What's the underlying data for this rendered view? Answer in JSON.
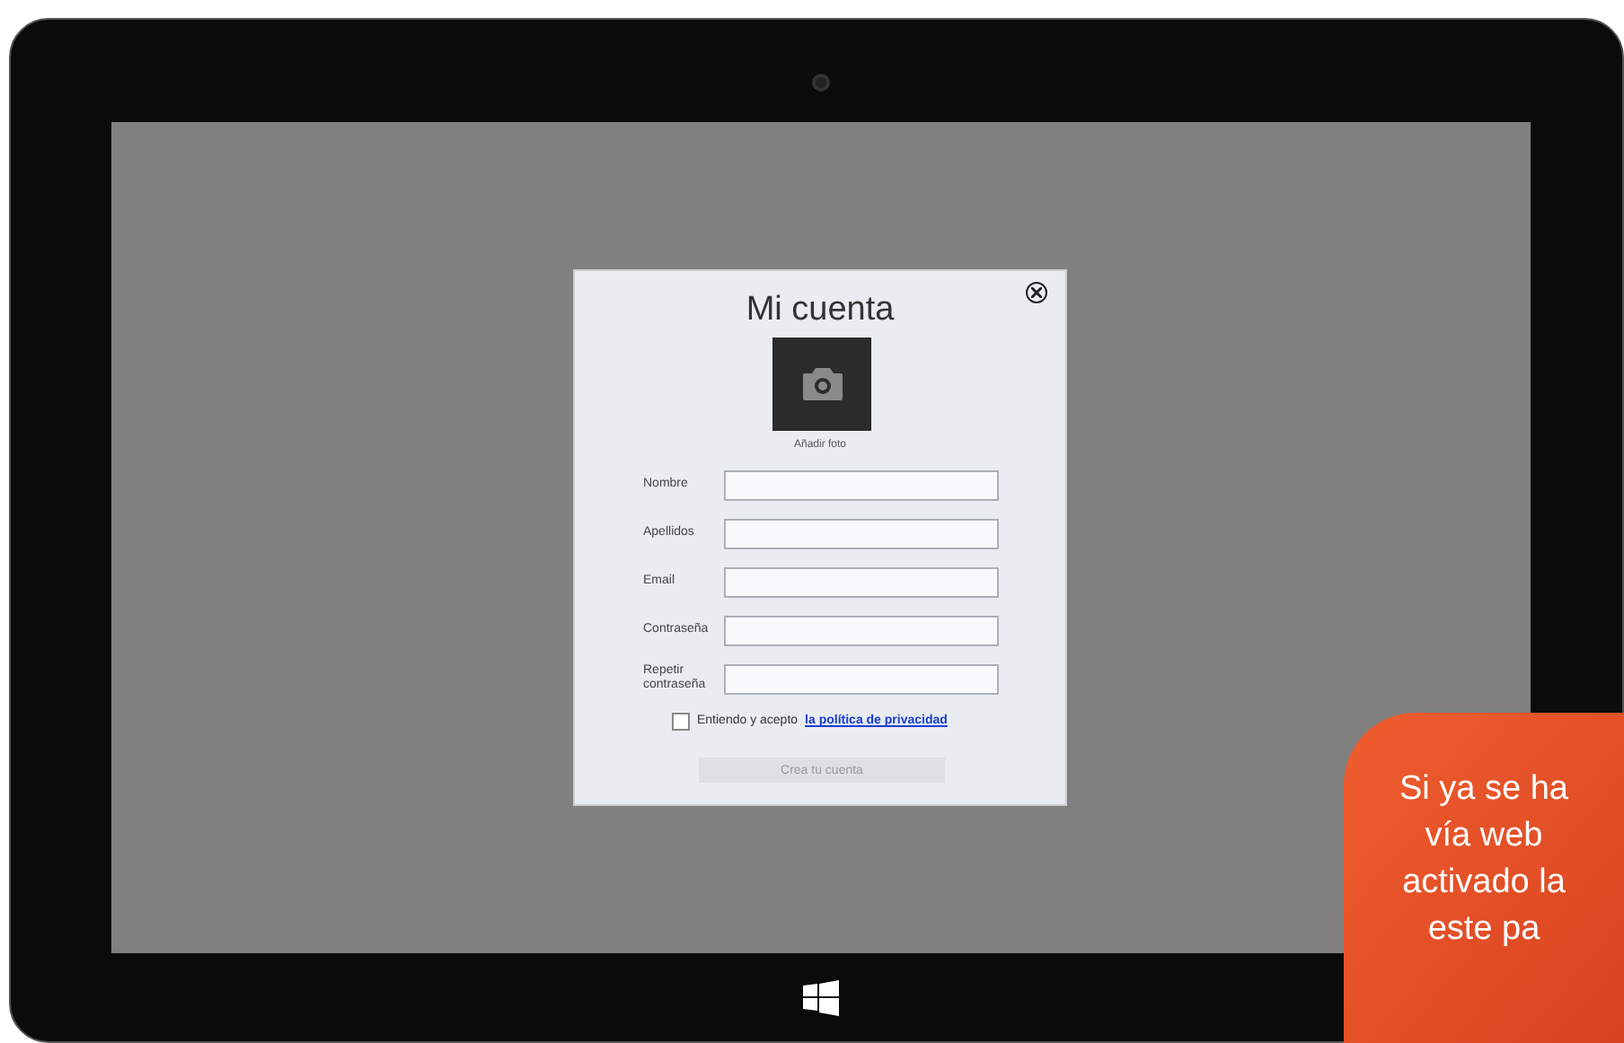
{
  "dialog": {
    "title": "Mi cuenta",
    "photo_label": "Añadir foto",
    "fields": [
      {
        "label": "Nombre"
      },
      {
        "label": "Apellidos"
      },
      {
        "label": "Email"
      },
      {
        "label": "Contraseña"
      },
      {
        "label": "Repetir contraseña"
      }
    ],
    "consent": {
      "checked": false,
      "text": "Entiendo y acepto",
      "link": "la política de privacidad"
    },
    "submit": {
      "label": "Crea tu cuenta",
      "disabled": true
    }
  },
  "callout": {
    "lines": [
      "Si ya se ha",
      "vía web",
      "activado la",
      "este pa"
    ]
  }
}
